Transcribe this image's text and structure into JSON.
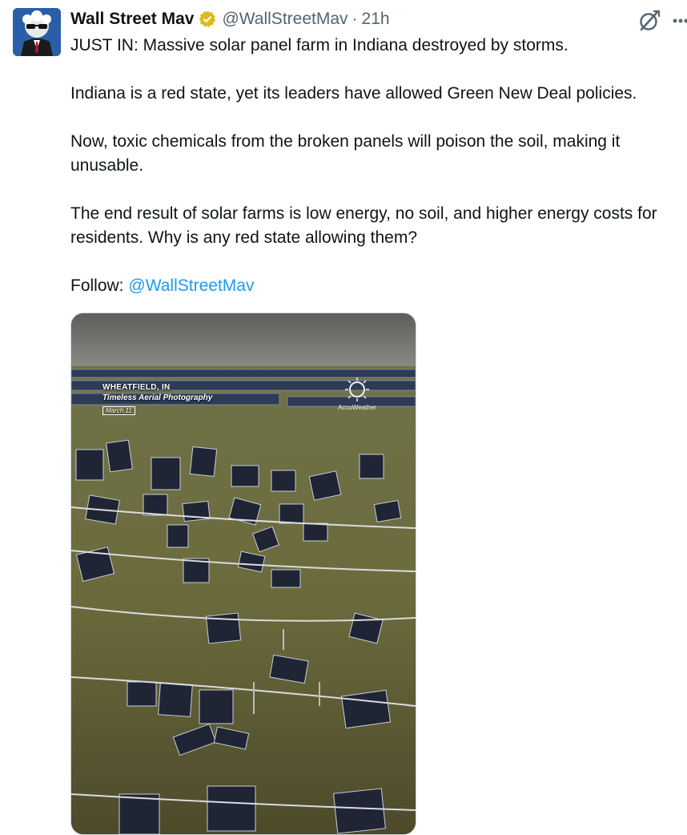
{
  "tweet": {
    "author_name": "Wall Street Mav",
    "handle": "@WallStreetMav",
    "separator": "·",
    "time": "21h",
    "paragraphs": [
      "JUST IN: Massive solar panel farm in Indiana destroyed by storms.",
      "Indiana is a red state, yet its leaders have allowed Green New Deal policies.",
      "Now, toxic chemicals from the broken panels will poison the soil, making it unusable.",
      "The end result of solar farms is low energy, no soil, and higher energy costs for residents. Why is any red state allowing them?"
    ],
    "follow_label": "Follow:",
    "follow_mention": "@WallStreetMav"
  },
  "icons": {
    "verified": "verified-badge-icon",
    "grok": "grok-icon",
    "more": "more-icon"
  },
  "colors": {
    "mention_blue": "#1d9bf0",
    "verified_gold": "#e2b719",
    "secondary_text": "#536471"
  },
  "media": {
    "overlay_location": "WHEATFIELD, IN",
    "overlay_credit": "Timeless Aerial Photography",
    "overlay_date": "March 11",
    "watermark": "AccuWeather"
  }
}
